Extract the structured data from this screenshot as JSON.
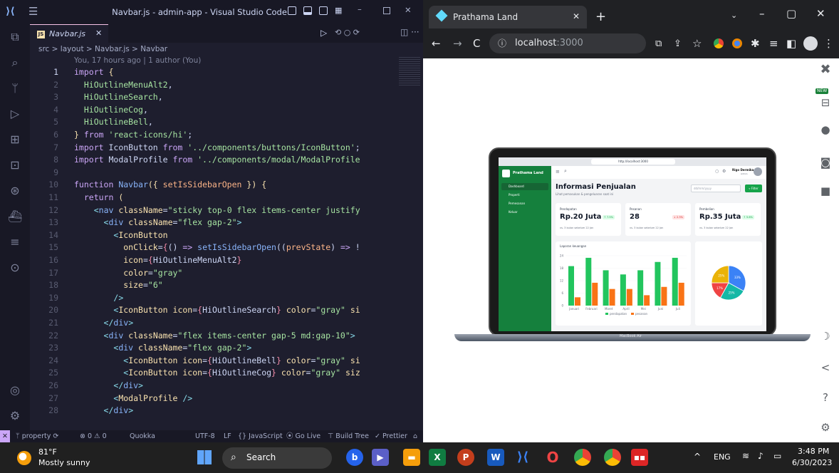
{
  "vscode": {
    "title": "Navbar.js - admin-app - Visual Studio Code",
    "tab_label": "Navbar.js",
    "breadcrumb": "src > layout > Navbar.js > Navbar",
    "blame": "You, 17 hours ago | 1 author (You)",
    "code_lines": [
      {
        "n": "1",
        "html": "<span class='k'>import</span> <span class='y'>{</span>"
      },
      {
        "n": "2",
        "html": "  <span class='g'>HiOutlineMenuAlt2</span>,"
      },
      {
        "n": "3",
        "html": "  <span class='g'>HiOutlineSearch</span>,"
      },
      {
        "n": "4",
        "html": "  <span class='g'>HiOutlineCog</span>,"
      },
      {
        "n": "5",
        "html": "  <span class='g'>HiOutlineBell</span>,"
      },
      {
        "n": "6",
        "html": "<span class='y'>}</span> <span class='k'>from</span> <span class='g'>'react-icons/hi'</span>;"
      },
      {
        "n": "7",
        "html": "<span class='k'>import</span> IconButton <span class='k'>from</span> <span class='g'>'../components/buttons/IconButton'</span>;"
      },
      {
        "n": "8",
        "html": "<span class='k'>import</span> ModalProfile <span class='k'>from</span> <span class='g'>'../components/modal/ModalProfile</span>"
      },
      {
        "n": "9",
        "html": ""
      },
      {
        "n": "10",
        "html": "<span class='k'>function</span> <span class='f'>Navbar</span><span class='y'>({</span> <span class='p'>setIsSidebarOpen</span> <span class='y'>})</span> <span class='y'>{</span>"
      },
      {
        "n": "11",
        "html": "  <span class='k'>return</span> <span class='y'>(</span>"
      },
      {
        "n": "12",
        "html": "    <span class='o'>&lt;</span><span class='f'>nav</span> <span class='y'>className</span>=<span class='g'>\"sticky top-0 flex items-center justify</span>"
      },
      {
        "n": "13",
        "html": "      <span class='o'>&lt;</span><span class='f'>div</span> <span class='y'>className</span>=<span class='g'>\"flex gap-2\"</span><span class='o'>&gt;</span>"
      },
      {
        "n": "14",
        "html": "        <span class='o'>&lt;</span><span class='y'>IconButton</span>"
      },
      {
        "n": "15",
        "html": "          <span class='y'>onClick</span>=<span class='r'>{</span>() <span class='k'>=&gt;</span> <span class='f'>setIsSidebarOpen</span>((<span class='p'>prevState</span>) <span class='k'>=&gt;</span> !"
      },
      {
        "n": "16",
        "html": "          <span class='y'>icon</span>=<span class='r'>{</span>HiOutlineMenuAlt2<span class='r'>}</span>"
      },
      {
        "n": "17",
        "html": "          <span class='y'>color</span>=<span class='g'>\"gray\"</span>"
      },
      {
        "n": "18",
        "html": "          <span class='y'>size</span>=<span class='g'>\"6\"</span>"
      },
      {
        "n": "19",
        "html": "        <span class='o'>/&gt;</span>"
      },
      {
        "n": "20",
        "html": "        <span class='o'>&lt;</span><span class='y'>IconButton</span> <span class='y'>icon</span>=<span class='r'>{</span>HiOutlineSearch<span class='r'>}</span> <span class='y'>color</span>=<span class='g'>\"gray\"</span> <span class='y'>si</span>"
      },
      {
        "n": "21",
        "html": "      <span class='o'>&lt;/</span><span class='f'>div</span><span class='o'>&gt;</span>"
      },
      {
        "n": "22",
        "html": "      <span class='o'>&lt;</span><span class='f'>div</span> <span class='y'>className</span>=<span class='g'>\"flex items-center gap-5 md:gap-10\"</span><span class='o'>&gt;</span>"
      },
      {
        "n": "23",
        "html": "        <span class='o'>&lt;</span><span class='f'>div</span> <span class='y'>className</span>=<span class='g'>\"flex gap-2\"</span><span class='o'>&gt;</span>"
      },
      {
        "n": "24",
        "html": "          <span class='o'>&lt;</span><span class='y'>IconButton</span> <span class='y'>icon</span>=<span class='r'>{</span>HiOutlineBell<span class='r'>}</span> <span class='y'>color</span>=<span class='g'>\"gray\"</span> <span class='y'>si</span>"
      },
      {
        "n": "25",
        "html": "          <span class='o'>&lt;</span><span class='y'>IconButton</span> <span class='y'>icon</span>=<span class='r'>{</span>HiOutlineCog<span class='r'>}</span> <span class='y'>color</span>=<span class='g'>\"gray\"</span> <span class='y'>siz</span>"
      },
      {
        "n": "26",
        "html": "        <span class='o'>&lt;/</span><span class='f'>div</span><span class='o'>&gt;</span>"
      },
      {
        "n": "27",
        "html": "        <span class='o'>&lt;</span><span class='y'>ModalProfile</span> <span class='o'>/&gt;</span>"
      },
      {
        "n": "28",
        "html": "      <span class='o'>&lt;/</span><span class='f'>div</span><span class='o'>&gt;</span>"
      }
    ],
    "status": {
      "branch": "property",
      "problems": "⊗ 0 ⚠ 0",
      "quokka": "Quokka",
      "encoding": "UTF-8",
      "eol": "LF",
      "language": "{} JavaScript",
      "golive": "Go Live",
      "buildtree": "Build Tree",
      "prettier": "Prettier"
    }
  },
  "browser": {
    "tab_title": "Prathama Land",
    "url_host": "localhost",
    "url_port": ":3000",
    "sidepanel_new": "NEW"
  },
  "app": {
    "brand": "Prathama Land",
    "menu": [
      "Dashboard",
      "Properti",
      "Pemesanan",
      "Keluar"
    ],
    "user_name": "Rigo Dermika",
    "user_role": "Admin",
    "heading": "Informasi Penjualan",
    "subheading": "Lihat pemasukan & pengeluaran saat ini",
    "date_placeholder": "dd/mm/yyyy",
    "filter_label": "Filter",
    "cards": [
      {
        "label": "Pendapatan",
        "value": "Rp.20 Juta",
        "badge": "7.5%",
        "badge_up": true,
        "note": "vs. 3 bulan sebelum 22 Jan"
      },
      {
        "label": "Pesanan",
        "value": "28",
        "badge": "2.3%",
        "badge_up": false,
        "note": "vs. 3 bulan sebelum 22 Jan"
      },
      {
        "label": "Pembelian",
        "value": "Rp.35 Juta",
        "badge": "5.6%",
        "badge_up": true,
        "note": "vs. 3 bulan sebelum 22 Jan"
      }
    ],
    "laptop_label": "MacBook Air",
    "mac_url": "http://localhost:3000"
  },
  "chart_data": [
    {
      "type": "bar",
      "title": "Laporan keuangan",
      "categories": [
        "Januari",
        "Februari",
        "Maret",
        "April",
        "Mei",
        "Juni",
        "Juli"
      ],
      "ylim": [
        0,
        24
      ],
      "yticks": [
        "0",
        "6",
        "12",
        "18",
        "24"
      ],
      "series": [
        {
          "name": "pendapatan",
          "color": "#22c55e",
          "values": [
            19,
            23,
            17,
            15,
            17,
            21,
            23
          ]
        },
        {
          "name": "pesanan",
          "color": "#f97316",
          "values": [
            4,
            11,
            8,
            8,
            5,
            9,
            11
          ]
        }
      ]
    },
    {
      "type": "pie",
      "labels": [
        "33%",
        "25%",
        "17%",
        "25%"
      ],
      "values": [
        33,
        25,
        17,
        25
      ],
      "colors": [
        "#3b82f6",
        "#14b8a6",
        "#ef4444",
        "#eab308"
      ]
    }
  ],
  "taskbar": {
    "weather_temp": "81°F",
    "weather_desc": "Mostly sunny",
    "search_label": "Search",
    "lang": "ENG",
    "time": "3:48 PM",
    "date": "6/30/2023"
  }
}
